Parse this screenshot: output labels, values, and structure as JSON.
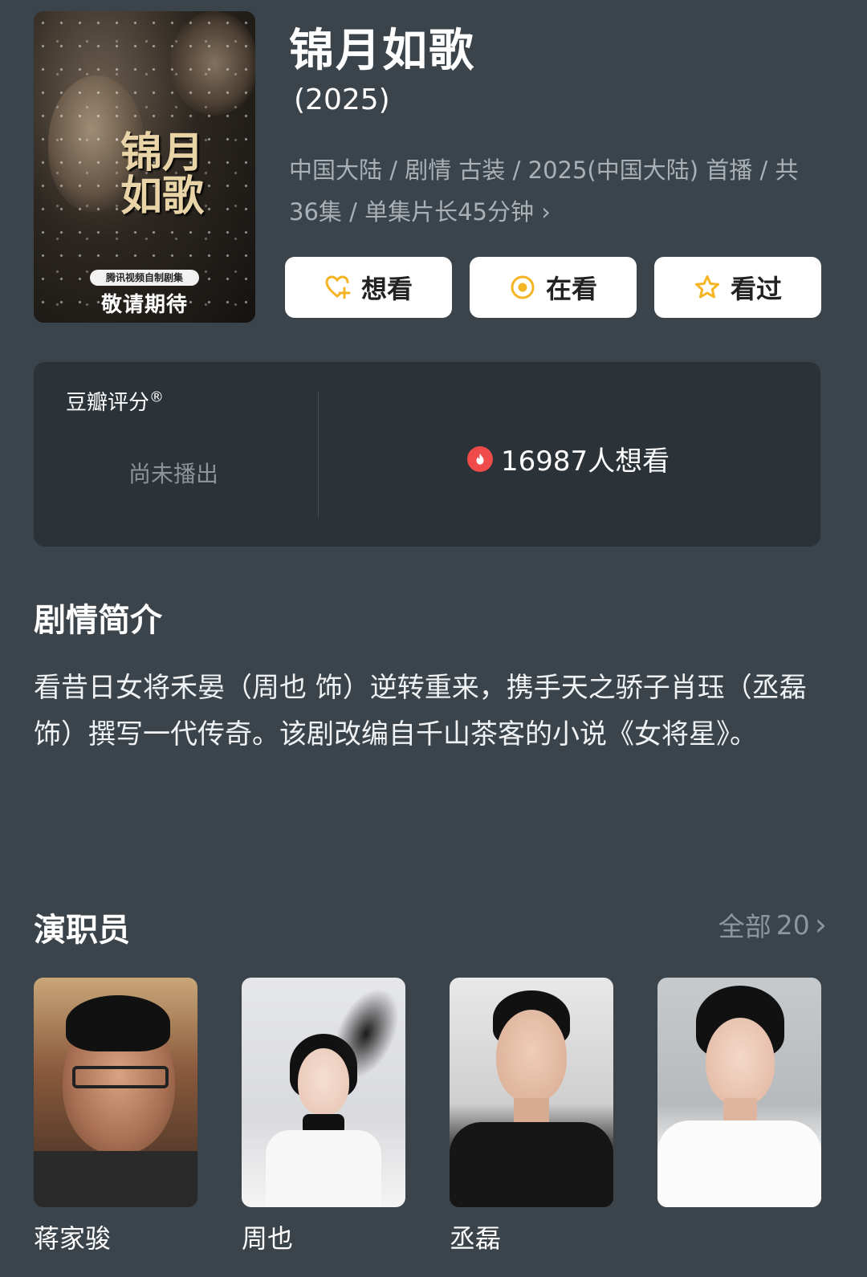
{
  "poster": {
    "calligraphy": "锦月如歌",
    "badge": "腾讯视频自制剧集",
    "tagline": "敬请期待"
  },
  "header": {
    "title": "锦月如歌",
    "year": "(2025)",
    "meta_line1": "中国大陆 / 剧情 古装 / 2025(中国大陆) 首播 / 共",
    "meta_line2": "36集 / 单集片长45分钟"
  },
  "actions": [
    {
      "label": "想看",
      "icon": "heart-plus-icon"
    },
    {
      "label": "在看",
      "icon": "target-circle-icon"
    },
    {
      "label": "看过",
      "icon": "star-icon"
    }
  ],
  "rating": {
    "label": "豆瓣评分",
    "trademark": "®",
    "status": "尚未播出",
    "wish_count": "16987人想看"
  },
  "synopsis": {
    "heading": "剧情简介",
    "text": "看昔日女将禾晏（周也 饰）逆转重来，携手天之骄子肖珏（丞磊 饰）撰写一代传奇。该剧改编自千山茶客的小说《女将星》。"
  },
  "cast": {
    "heading": "演职员",
    "all_label": "全部",
    "all_count": "20",
    "members": [
      {
        "name": "蒋家骏"
      },
      {
        "name": "周也"
      },
      {
        "name": "丞磊"
      },
      {
        "name": ""
      }
    ]
  },
  "colors": {
    "background": "#3b444b",
    "card": "#2b3238",
    "accent": "#f5b423",
    "muted": "#a9b1b7",
    "fire": "#ef4b4b"
  }
}
